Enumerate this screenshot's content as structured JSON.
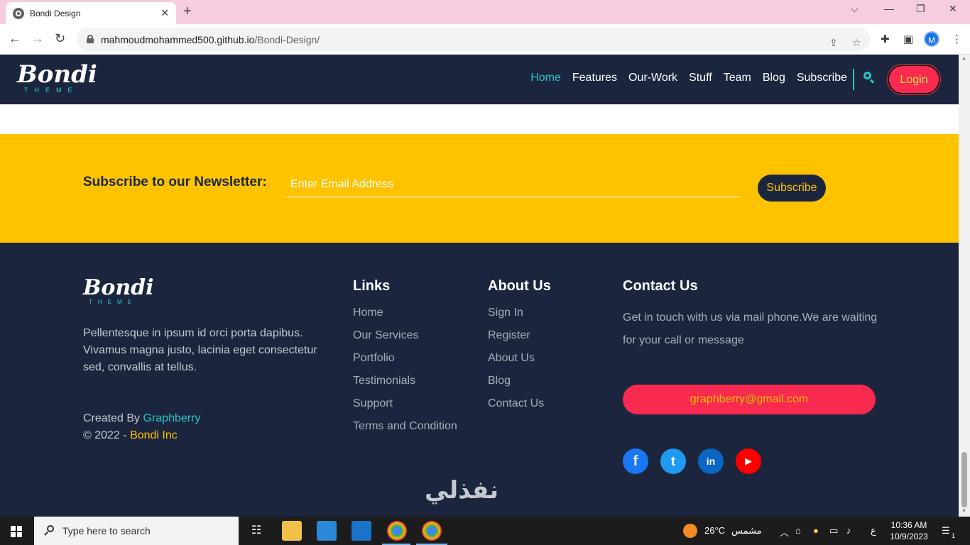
{
  "browser": {
    "tab_title": "Bondi Design",
    "url_host": "mahmoudmohammed500.github.io",
    "url_path": "/Bondi-Design/",
    "profile_initial": "M"
  },
  "site": {
    "logo_text": "Bondi",
    "logo_sub": "THEME",
    "nav": [
      "Home",
      "Features",
      "Our-Work",
      "Stuff",
      "Team",
      "Blog",
      "Subscribe"
    ],
    "nav_active": "Home",
    "login_label": "Login"
  },
  "newsletter": {
    "label": "Subscribe to our Newsletter:",
    "placeholder": "Enter Email Address",
    "button": "Subscribe"
  },
  "footer": {
    "description": "Pellentesque in ipsum id orci porta dapibus. Vivamus magna justo, lacinia eget consectetur sed, convallis at tellus.",
    "created_by_prefix": "Created By",
    "created_by_name": "Graphberry",
    "copyright_prefix": "© 2022 -",
    "copyright_name": "Bondi Inc",
    "links_title": "Links",
    "links": [
      "Home",
      "Our Services",
      "Portfolio",
      "Testimonials",
      "Support",
      "Terms and Condition"
    ],
    "about_title": "About Us",
    "about": [
      "Sign In",
      "Register",
      "About Us",
      "Blog",
      "Contact Us"
    ],
    "contact_title": "Contact Us",
    "contact_text": "Get in touch with us via mail phone.We are waiting for your call or message",
    "contact_email": "graphberry@gmail.com",
    "social": [
      {
        "name": "facebook-icon",
        "glyph": "f",
        "color": "#1877f2"
      },
      {
        "name": "twitter-icon",
        "glyph": "t",
        "color": "#1d9bf0"
      },
      {
        "name": "linkedin-icon",
        "glyph": "in",
        "color": "#0a66c2"
      },
      {
        "name": "youtube-icon",
        "glyph": "▶",
        "color": "#ff0000"
      }
    ],
    "watermark": "نفذلي"
  },
  "colors": {
    "navy": "#1b263e",
    "yellow": "#fec300",
    "pink_red": "#f82a4f",
    "teal": "#27c6c6"
  },
  "taskbar": {
    "search_placeholder": "Type here to search",
    "weather_temp": "26°C",
    "weather_label": "مشمس",
    "lang": "ع",
    "time": "10:36 AM",
    "date": "10/9/2023",
    "notifications": "1"
  }
}
